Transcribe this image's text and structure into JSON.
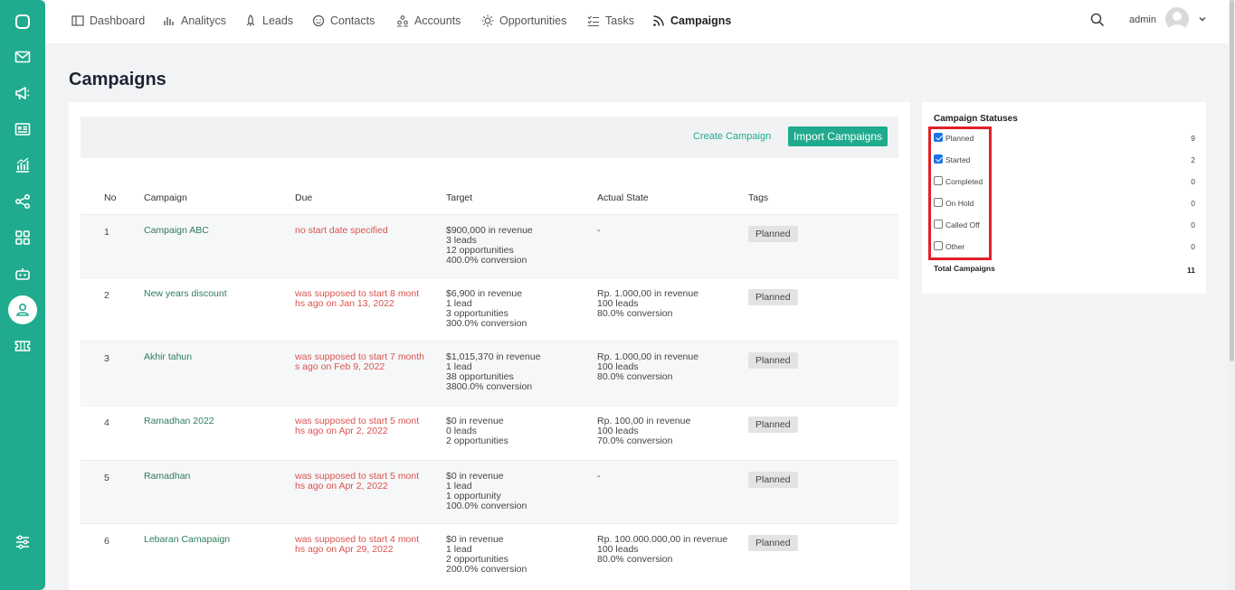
{
  "nav": {
    "items": [
      {
        "label": "Dashboard",
        "icon": "layout-icon"
      },
      {
        "label": "Analitycs",
        "icon": "bar-chart-icon"
      },
      {
        "label": "Leads",
        "icon": "rocket-icon"
      },
      {
        "label": "Contacts",
        "icon": "smile-icon"
      },
      {
        "label": "Accounts",
        "icon": "people-icon"
      },
      {
        "label": "Opportunities",
        "icon": "sun-icon"
      },
      {
        "label": "Tasks",
        "icon": "checklist-icon"
      },
      {
        "label": "Campaigns",
        "icon": "rss-icon"
      }
    ],
    "user": "admin"
  },
  "sidebar": {
    "icons": [
      "app-logo-icon",
      "mail-icon",
      "megaphone-icon",
      "id-card-icon",
      "chart-icon",
      "share-icon",
      "grid-icon",
      "robot-icon",
      "user-icon",
      "ticket-icon",
      "settings-sliders-icon"
    ]
  },
  "page": {
    "title": "Campaigns",
    "create_label": "Create Campaign",
    "import_label": "Import Campaigns"
  },
  "table": {
    "headers": {
      "no": "No",
      "campaign": "Campaign",
      "due": "Due",
      "target": "Target",
      "actual": "Actual State",
      "tags": "Tags"
    },
    "rows": [
      {
        "no": "1",
        "campaign": "Campaign ABC",
        "due": [
          "no start date specified"
        ],
        "target": [
          "$900,000 in revenue",
          "3 leads",
          "12 opportunities",
          "400.0% conversion"
        ],
        "actual": [
          "-"
        ],
        "tag": "Planned"
      },
      {
        "no": "2",
        "campaign": "New years discount",
        "due": [
          "was supposed to start 8 mont",
          "hs ago on Jan 13, 2022"
        ],
        "target": [
          "$6,900 in revenue",
          "1 lead",
          "3 opportunities",
          "300.0% conversion"
        ],
        "actual": [
          "Rp. 1.000,00 in revenue",
          "100 leads",
          "80.0% conversion"
        ],
        "tag": "Planned"
      },
      {
        "no": "3",
        "campaign": "Akhir tahun",
        "due": [
          "was supposed to start 7 month",
          "s ago on Feb 9, 2022"
        ],
        "target": [
          "$1,015,370 in revenue",
          "1 lead",
          "38 opportunities",
          "3800.0% conversion"
        ],
        "actual": [
          "Rp. 1.000,00 in revenue",
          "100 leads",
          "80.0% conversion"
        ],
        "tag": "Planned"
      },
      {
        "no": "4",
        "campaign": "Ramadhan 2022",
        "due": [
          "was supposed to start 5 mont",
          "hs ago on Apr 2, 2022"
        ],
        "target": [
          "$0 in revenue",
          "0 leads",
          "2 opportunities"
        ],
        "actual": [
          "Rp. 100,00 in revenue",
          "100 leads",
          "70.0% conversion"
        ],
        "tag": "Planned"
      },
      {
        "no": "5",
        "campaign": "Ramadhan",
        "due": [
          "was supposed to start 5 mont",
          "hs ago on Apr 2, 2022"
        ],
        "target": [
          "$0 in revenue",
          "1 lead",
          "1 opportunity",
          "100.0% conversion"
        ],
        "actual": [
          "-"
        ],
        "tag": "Planned"
      },
      {
        "no": "6",
        "campaign": "Lebaran Camapaign",
        "due": [
          "was supposed to start 4 mont",
          "hs ago on Apr 29, 2022"
        ],
        "target": [
          "$0 in revenue",
          "1 lead",
          "2 opportunities",
          "200.0% conversion"
        ],
        "actual": [
          "Rp. 100.000.000,00 in revenue",
          "100 leads",
          "80.0% conversion"
        ],
        "tag": "Planned"
      }
    ]
  },
  "statuses": {
    "title": "Campaign Statuses",
    "items": [
      {
        "label": "Planned",
        "count": "9",
        "checked": true
      },
      {
        "label": "Started",
        "count": "2",
        "checked": true
      },
      {
        "label": "Completed",
        "count": "0",
        "checked": false
      },
      {
        "label": "On Hold",
        "count": "0",
        "checked": false
      },
      {
        "label": "Called Off",
        "count": "0",
        "checked": false
      },
      {
        "label": "Other",
        "count": "0",
        "checked": false
      }
    ],
    "total_label": "Total Campaigns",
    "total_count": "11"
  }
}
